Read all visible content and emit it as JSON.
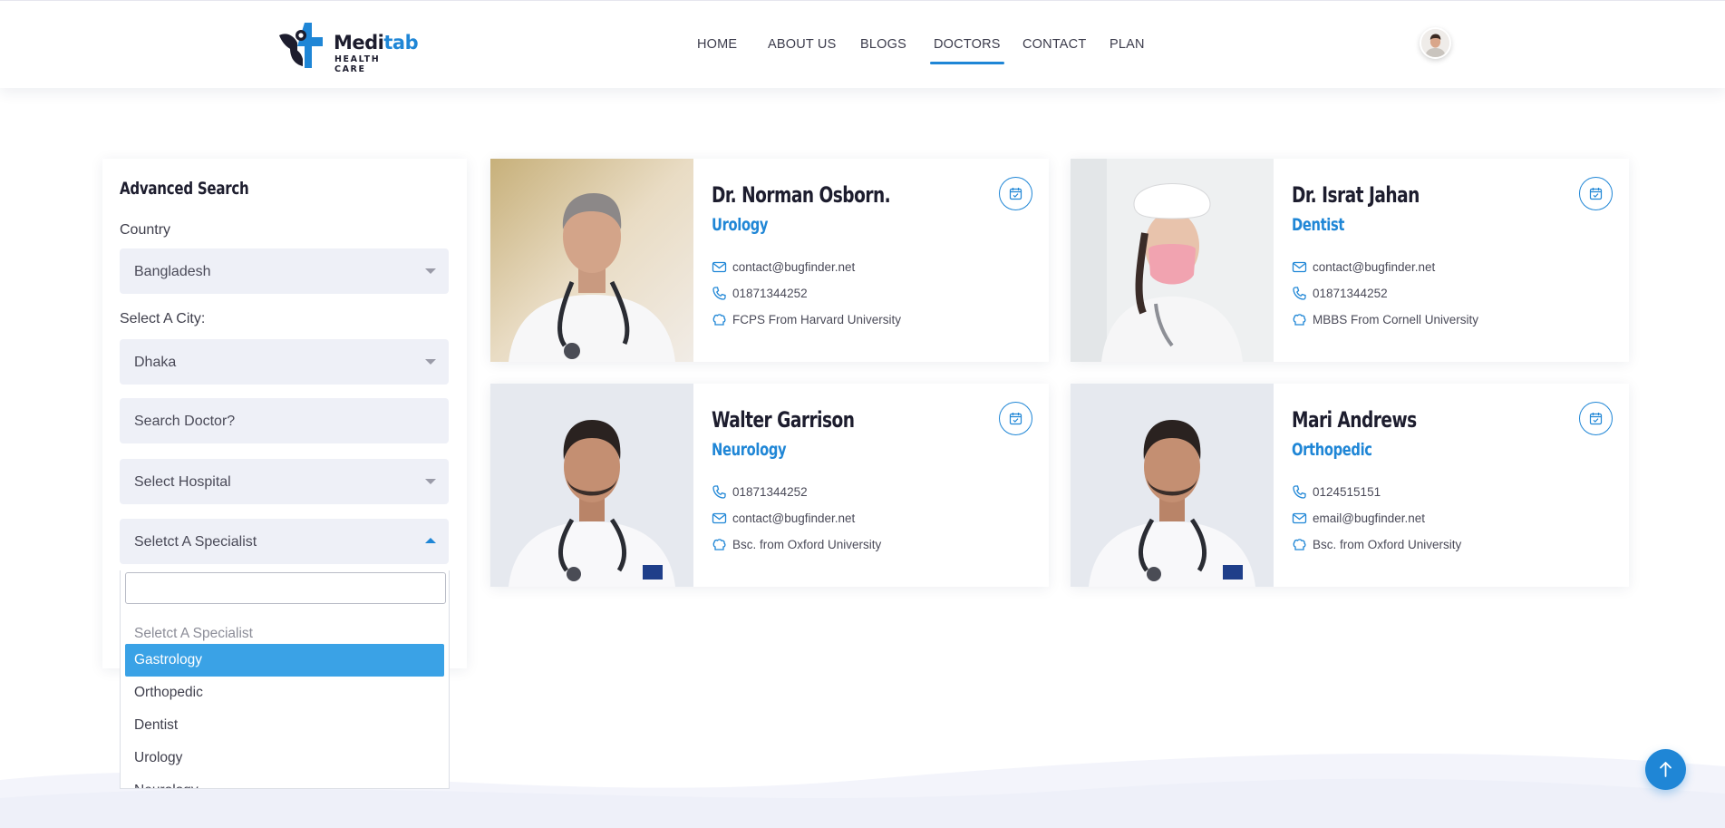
{
  "header": {
    "brand_part1": "Medi",
    "brand_part2": "tab",
    "tagline": "HEALTH CARE",
    "nav": [
      "HOME",
      "ABOUT US",
      "BLOGS",
      "DOCTORS",
      "CONTACT",
      "PLAN"
    ],
    "active_nav": "DOCTORS"
  },
  "sidebar": {
    "title": "Advanced Search",
    "country_label": "Country",
    "country_value": "Bangladesh",
    "city_label": "Select A City:",
    "city_value": "Dhaka",
    "search_placeholder": "Search Doctor?",
    "hospital_value": "Select Hospital",
    "specialist_value": "Seletct A Specialist",
    "specialist_options": [
      "Seletct A Specialist",
      "Gastrology",
      "Orthopedic",
      "Dentist",
      "Urology",
      "Neurology"
    ],
    "selected_option": "Gastrology"
  },
  "doctors": [
    {
      "name": "Dr. Norman Osborn.",
      "specialty": "Urology",
      "info": [
        {
          "icon": "envelope-icon",
          "text": "contact@bugfinder.net"
        },
        {
          "icon": "phone-icon",
          "text": "01871344252"
        },
        {
          "icon": "education-icon",
          "text": "FCPS From Harvard University"
        }
      ]
    },
    {
      "name": "Dr. Israt Jahan",
      "specialty": "Dentist",
      "info": [
        {
          "icon": "envelope-icon",
          "text": "contact@bugfinder.net"
        },
        {
          "icon": "phone-icon",
          "text": "01871344252"
        },
        {
          "icon": "education-icon",
          "text": "MBBS From Cornell University"
        }
      ]
    },
    {
      "name": "Walter Garrison",
      "specialty": "Neurology",
      "info": [
        {
          "icon": "phone-icon",
          "text": "01871344252"
        },
        {
          "icon": "envelope-icon",
          "text": "contact@bugfinder.net"
        },
        {
          "icon": "education-icon",
          "text": "Bsc. from Oxford University"
        }
      ]
    },
    {
      "name": "Mari Andrews",
      "specialty": "Orthopedic",
      "info": [
        {
          "icon": "phone-icon",
          "text": "0124515151"
        },
        {
          "icon": "envelope-icon",
          "text": "email@bugfinder.net"
        },
        {
          "icon": "education-icon",
          "text": "Bsc. from Oxford University"
        }
      ]
    }
  ],
  "colors": {
    "accent": "#1f86d6",
    "selected_option_bg": "#3aa2e6",
    "field_bg": "#eef0f7"
  }
}
